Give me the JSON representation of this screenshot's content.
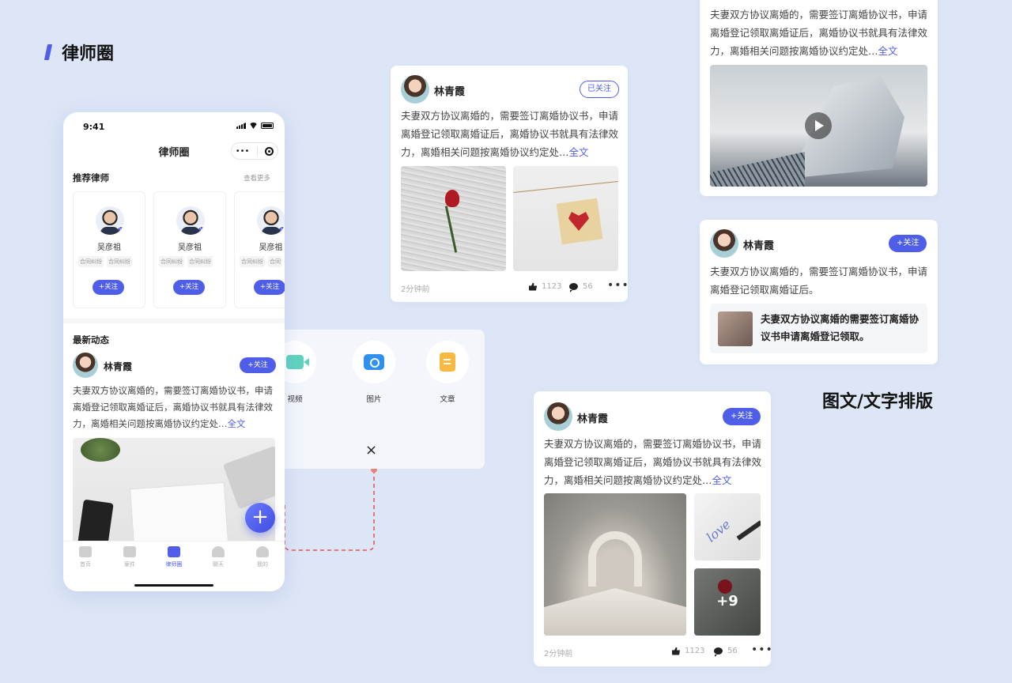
{
  "section_title": "律师圈",
  "section2_title": "图文/文字排版",
  "phone": {
    "time": "9:41",
    "nav_title": "律师圈",
    "capsule_dots": "•••",
    "rec_title": "推荐律师",
    "rec_more": "查看更多",
    "lawyers": [
      {
        "name": "吴彦祖",
        "tags": [
          "合同纠纷",
          "合同纠纷"
        ],
        "follow": "+关注"
      },
      {
        "name": "吴彦祖",
        "tags": [
          "合同纠纷",
          "合同纠纷"
        ],
        "follow": "+关注"
      },
      {
        "name": "吴彦祖",
        "tags": [
          "合同纠纷",
          "合同"
        ],
        "follow": "+关注"
      }
    ],
    "news_title": "最新动态",
    "post": {
      "user": "林青霞",
      "follow": "+关注",
      "text": "夫妻双方协议离婚的，需要签订离婚协议书，申请离婚登记领取离婚证后，离婚协议书就具有法律效力，离婚相关问题按离婚协议约定处…",
      "more": "全文"
    },
    "fab": "+",
    "tabs": [
      "首页",
      "案件",
      "律师圈",
      "聊天",
      "我的"
    ]
  },
  "publish": {
    "items": [
      {
        "label": "视频",
        "icon": "video-icon"
      },
      {
        "label": "图片",
        "icon": "camera-icon"
      },
      {
        "label": "文章",
        "icon": "document-icon"
      }
    ],
    "close": "×"
  },
  "card_a": {
    "user": "林青霞",
    "followed": "已关注",
    "text": "夫妻双方协议离婚的，需要签订离婚协议书，申请离婚登记领取离婚证后，离婚协议书就具有法律效力，离婚相关问题按离婚协议约定处…",
    "more": "全文",
    "time": "2分钟前",
    "likes": "1123",
    "comments": "56",
    "dots": "•••"
  },
  "card_b": {
    "text": "夫妻双方协议离婚的，需要签订离婚协议书，申请离婚登记领取离婚证后，离婚协议书就具有法律效力，离婚相关问题按离婚协议约定处…",
    "more": "全文"
  },
  "card_c": {
    "user": "林青霞",
    "follow": "+关注",
    "text": "夫妻双方协议离婚的，需要签订离婚协议书，申请离婚登记领取离婚证后。",
    "link_text": "夫妻双方协议离婚的需要签订离婚协议书申请离婚登记领取。"
  },
  "card_d": {
    "user": "林青霞",
    "follow": "+关注",
    "text": "夫妻双方协议离婚的，需要签订离婚协议书，申请离婚登记领取离婚证后，离婚协议书就具有法律效力，离婚相关问题按离婚协议约定处…",
    "more": "全文",
    "more_count": "+9",
    "time": "2分钟前",
    "likes": "1123",
    "comments": "56",
    "dots": "•••"
  },
  "colors": {
    "accent": "#4f5ee8",
    "background": "#dde6f6"
  }
}
